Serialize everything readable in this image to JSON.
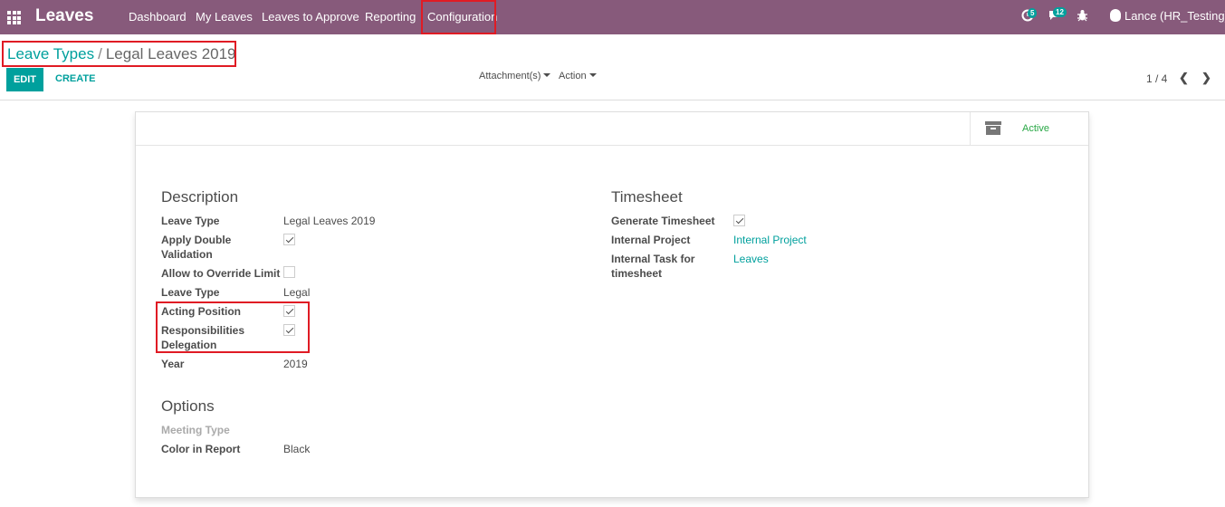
{
  "navbar": {
    "brand": "Leaves",
    "menu": [
      "Dashboard",
      "My Leaves",
      "Leaves to Approve",
      "Reporting",
      "Configuration"
    ],
    "activity_badge": "5",
    "messages_badge": "12",
    "user": "Lance (HR_Testing)"
  },
  "breadcrumb": {
    "parent": "Leave Types",
    "separator": "/",
    "current": "Legal Leaves 2019"
  },
  "buttons": {
    "edit": "EDIT",
    "create": "CREATE",
    "attachments": "Attachment(s)",
    "action": "Action"
  },
  "pager": {
    "value": "1 / 4"
  },
  "status": {
    "active": "Active"
  },
  "description": {
    "title": "Description",
    "leave_type_label": "Leave Type",
    "leave_type_value": "Legal Leaves 2019",
    "double_validation_label": "Apply Double Validation",
    "double_validation_checked": true,
    "override_label": "Allow to Override Limit",
    "override_checked": false,
    "leave_type2_label": "Leave Type",
    "leave_type2_value": "Legal",
    "acting_label": "Acting Position",
    "acting_checked": true,
    "delegation_label": "Responsibilities Delegation",
    "delegation_checked": true,
    "year_label": "Year",
    "year_value": "2019"
  },
  "timesheet": {
    "title": "Timesheet",
    "generate_label": "Generate Timesheet",
    "generate_checked": true,
    "project_label": "Internal Project",
    "project_value": "Internal Project",
    "task_label": "Internal Task for timesheet",
    "task_value": "Leaves"
  },
  "options": {
    "title": "Options",
    "meeting_label": "Meeting Type",
    "color_label": "Color in Report",
    "color_value": "Black"
  },
  "colors": {
    "navbar": "#875a7b",
    "accent": "#00a09d",
    "highlight": "#e01b24",
    "active": "#28a745"
  }
}
